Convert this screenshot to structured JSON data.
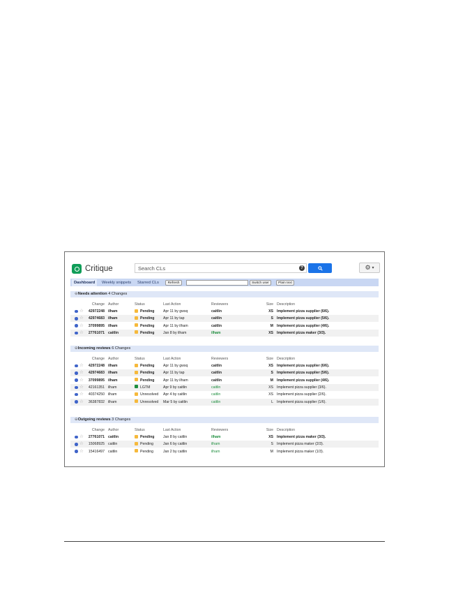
{
  "app": {
    "name": "Critique"
  },
  "search": {
    "placeholder": "Search CLs"
  },
  "nav": {
    "tabs": [
      "Dashboard",
      "Weekly snippets",
      "Starred CLs"
    ],
    "refresh": "Refresh",
    "switch_user": "Switch user",
    "plain_text": "Plain text"
  },
  "columns": [
    "Change",
    "Author",
    "Status",
    "Last Action",
    "Reviewers",
    "Size",
    "Description"
  ],
  "colors": {
    "pending": "#f6b93b",
    "lgtm": "#1e8e3e",
    "unresolved": "#f6b93b",
    "accent": "#1a73e8"
  },
  "sections": [
    {
      "title": "Needs attention",
      "count": "4 Changes",
      "rows": [
        {
          "change": "42972248",
          "author": "ilham",
          "status": "Pending",
          "action": "Apr 11 by gwsq",
          "reviewers": "caitlin",
          "size": "XS",
          "desc": "Implement pizza supplier (6/6).",
          "bold": true,
          "green_rev": false
        },
        {
          "change": "42974683",
          "author": "ilham",
          "status": "Pending",
          "action": "Apr 11 by tap",
          "reviewers": "caitlin",
          "size": "S",
          "desc": "Implement pizza supplier (5/6).",
          "bold": true,
          "green_rev": false
        },
        {
          "change": "37099895",
          "author": "ilham",
          "status": "Pending",
          "action": "Apr 11 by ilham",
          "reviewers": "caitlin",
          "size": "M",
          "desc": "Implement pizza supplier (4/6).",
          "bold": true,
          "green_rev": false
        },
        {
          "change": "27761071",
          "author": "caitlin",
          "status": "Pending",
          "action": "Jan 8 by ilham",
          "reviewers": "ilham",
          "size": "XS",
          "desc": "Implement pizza maker (3/3).",
          "bold": true,
          "green_rev": true
        }
      ]
    },
    {
      "title": "Incoming reviews",
      "count": "6 Changes",
      "rows": [
        {
          "change": "42972248",
          "author": "ilham",
          "status": "Pending",
          "action": "Apr 11 by gwsq",
          "reviewers": "caitlin",
          "size": "XS",
          "desc": "Implement pizza supplier (6/6).",
          "bold": true,
          "green_rev": false
        },
        {
          "change": "42974683",
          "author": "ilham",
          "status": "Pending",
          "action": "Apr 11 by tap",
          "reviewers": "caitlin",
          "size": "S",
          "desc": "Implement pizza supplier (5/6).",
          "bold": true,
          "green_rev": false
        },
        {
          "change": "37099895",
          "author": "ilham",
          "status": "Pending",
          "action": "Apr 11 by ilham",
          "reviewers": "caitlin",
          "size": "M",
          "desc": "Implement pizza supplier (4/6).",
          "bold": true,
          "green_rev": false
        },
        {
          "change": "42161351",
          "author": "ilham",
          "status": "LGTM",
          "action": "Apr 9 by caitlin",
          "reviewers": "caitlin",
          "size": "XS",
          "desc": "Implement pizza supplier (3/6).",
          "bold": false,
          "green_rev": true
        },
        {
          "change": "40374250",
          "author": "ilham",
          "status": "Unresolved",
          "action": "Apr 4 by caitlin",
          "reviewers": "caitlin",
          "size": "XS",
          "desc": "Implement pizza supplier (2/6).",
          "bold": false,
          "green_rev": true
        },
        {
          "change": "36387832",
          "author": "ilham",
          "status": "Unresolved",
          "action": "Mar 5 by caitlin",
          "reviewers": "caitlin",
          "size": "L",
          "desc": "Implement pizza supplier (1/6).",
          "bold": false,
          "green_rev": true
        }
      ]
    },
    {
      "title": "Outgoing reviews",
      "count": "3 Changes",
      "rows": [
        {
          "change": "27761071",
          "author": "caitlin",
          "status": "Pending",
          "action": "Jan 8 by caitlin",
          "reviewers": "ilham",
          "size": "XS",
          "desc": "Implement pizza maker (3/3).",
          "bold": true,
          "green_rev": true
        },
        {
          "change": "15068925",
          "author": "caitlin",
          "status": "Pending",
          "action": "Jan 6 by caitlin",
          "reviewers": "ilham",
          "size": "S",
          "desc": "Implement pizza maker (2/3).",
          "bold": false,
          "green_rev": true
        },
        {
          "change": "15416497",
          "author": "caitlin",
          "status": "Pending",
          "action": "Jan 2 by caitlin",
          "reviewers": "ilham",
          "size": "M",
          "desc": "Implement pizza maker (1/3).",
          "bold": false,
          "green_rev": true
        }
      ]
    }
  ]
}
